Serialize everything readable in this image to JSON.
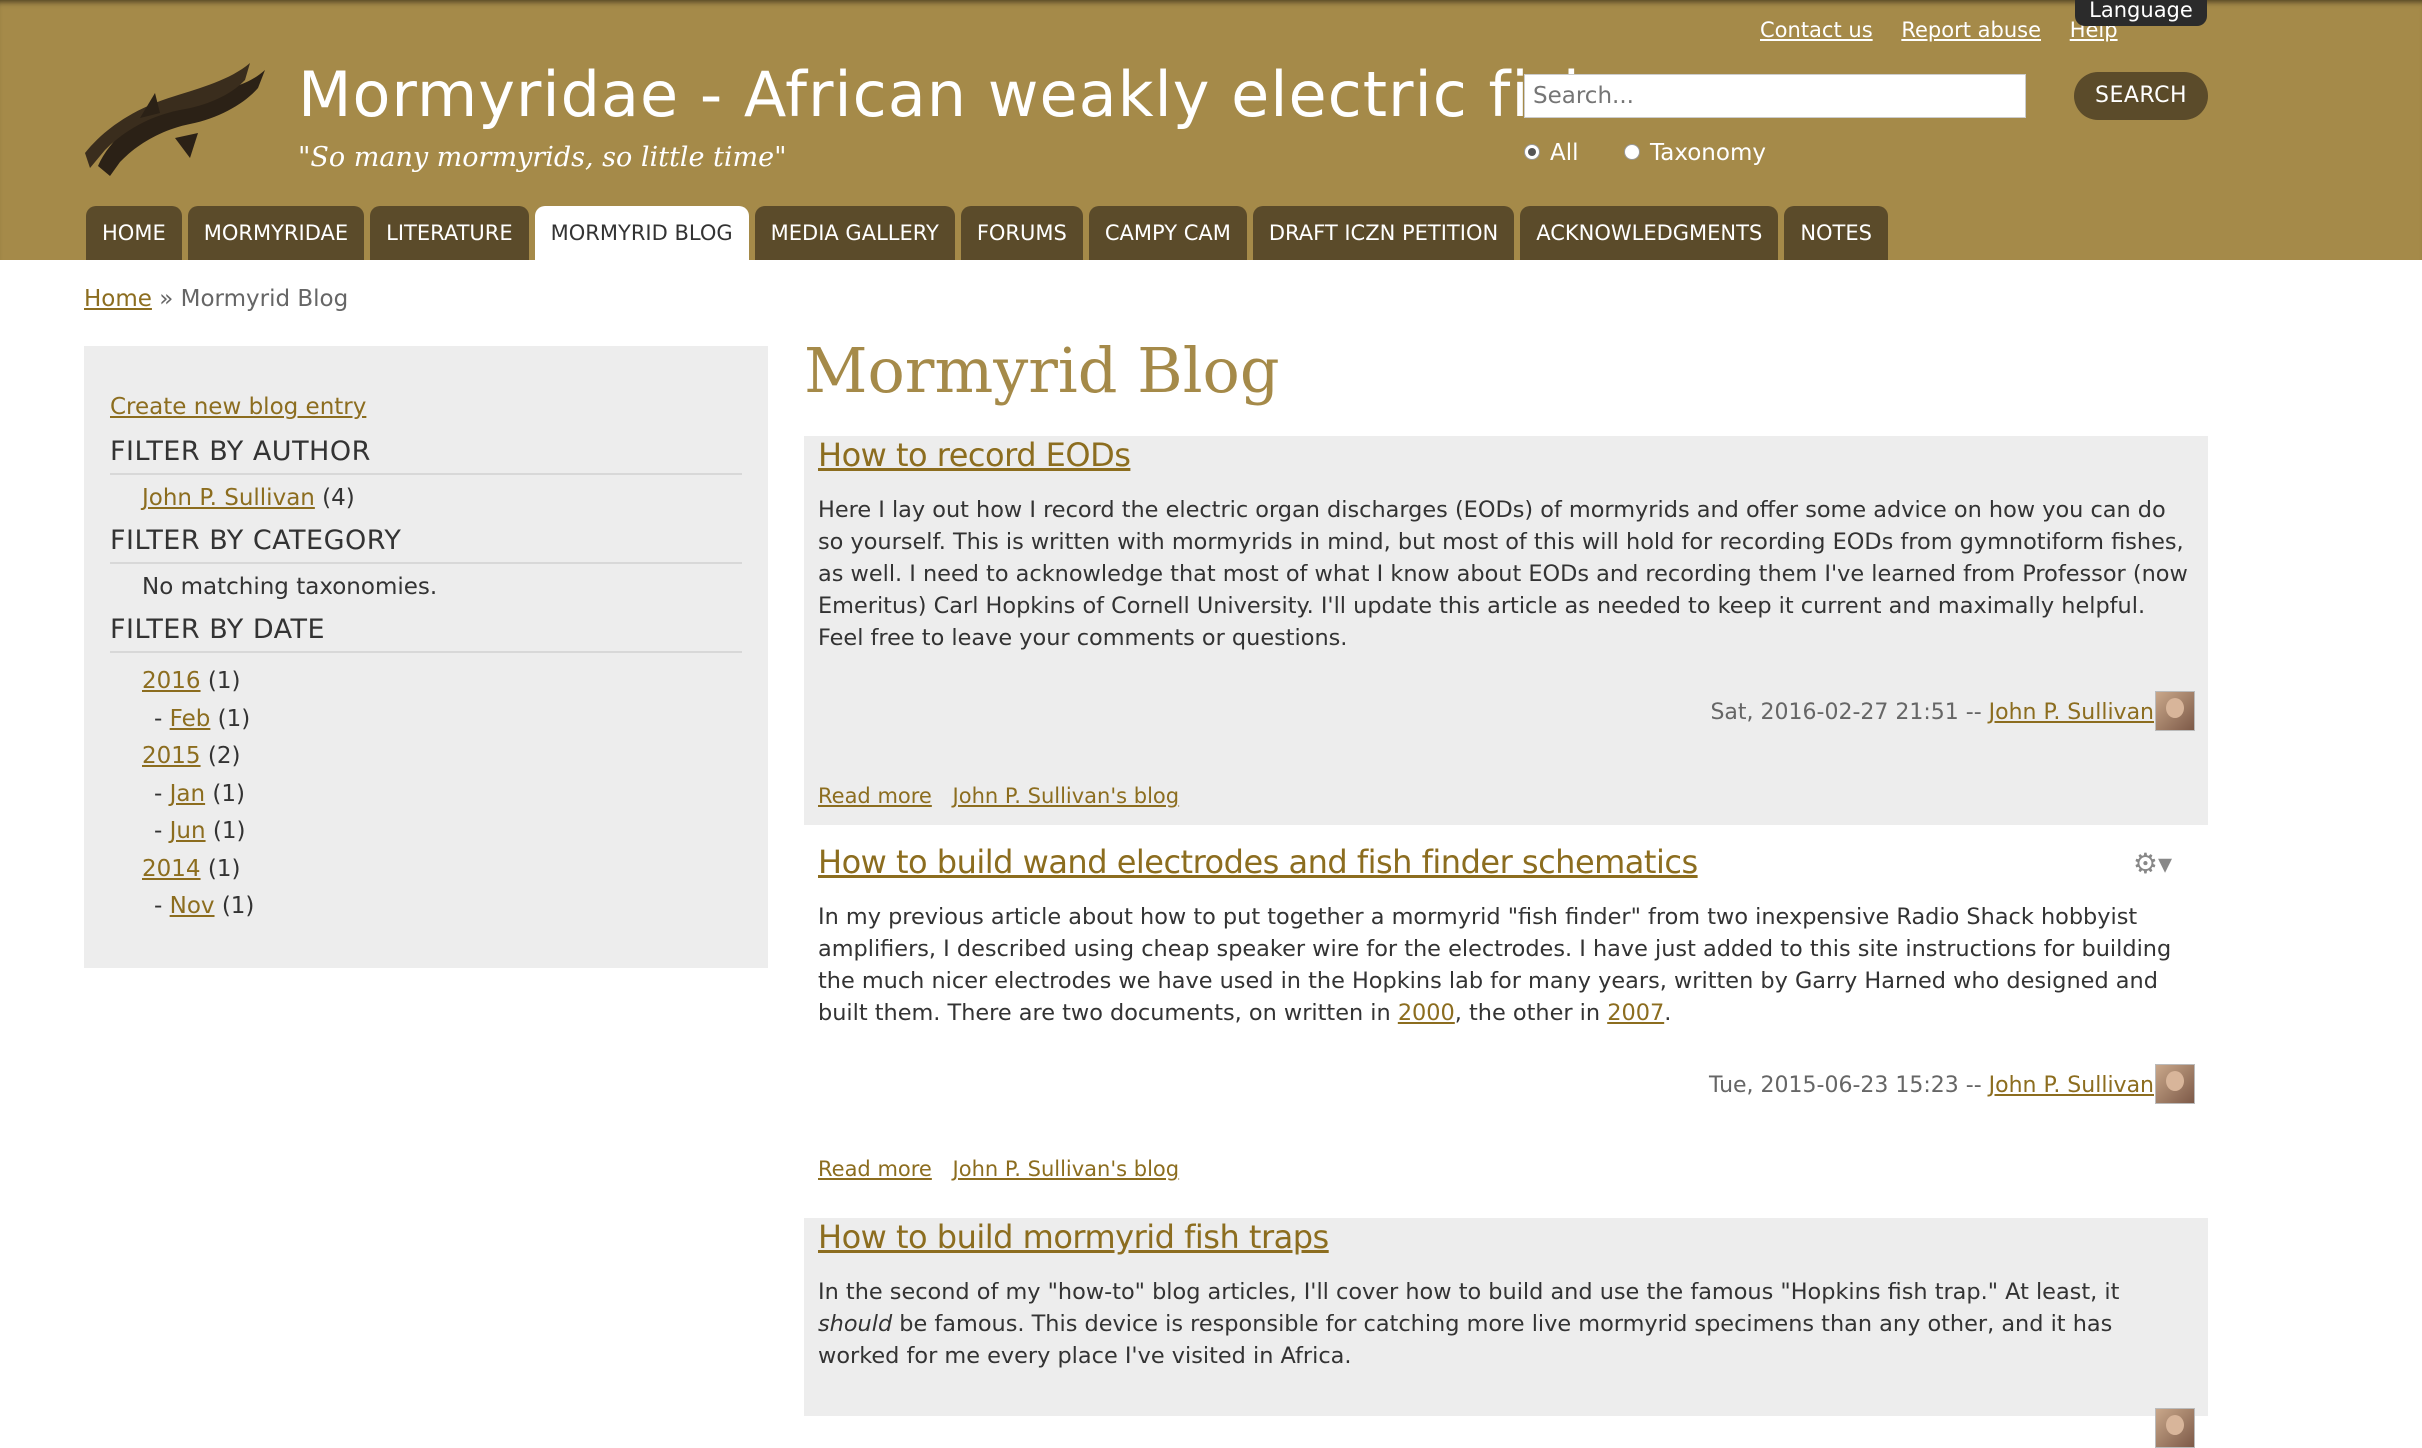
{
  "site": {
    "name": "Mormyridae - African weakly electric fishes",
    "slogan": "\"So many mormyrids, so little time\"",
    "secondary_links": [
      "Contact us",
      "Report abuse",
      "Help"
    ],
    "language_label": "Language"
  },
  "search": {
    "placeholder": "Search...",
    "button_label": "SEARCH",
    "options": [
      {
        "label": "All",
        "checked": true
      },
      {
        "label": "Taxonomy",
        "checked": false
      }
    ]
  },
  "nav": {
    "tabs": [
      {
        "label": "HOME",
        "active": false
      },
      {
        "label": "MORMYRIDAE",
        "active": false
      },
      {
        "label": "LITERATURE",
        "active": false
      },
      {
        "label": "MORMYRID BLOG",
        "active": true
      },
      {
        "label": "MEDIA GALLERY",
        "active": false
      },
      {
        "label": "FORUMS",
        "active": false
      },
      {
        "label": "CAMPY CAM",
        "active": false
      },
      {
        "label": "DRAFT ICZN PETITION",
        "active": false
      },
      {
        "label": "ACKNOWLEDGMENTS",
        "active": false
      },
      {
        "label": "NOTES",
        "active": false
      }
    ]
  },
  "breadcrumb": {
    "home": "Home",
    "sep": "»",
    "current": "Mormyrid Blog"
  },
  "sidebar": {
    "create_link": "Create new blog entry",
    "filter_author": {
      "title": "FILTER BY AUTHOR",
      "author": "John P. Sullivan",
      "count": "(4)"
    },
    "filter_category": {
      "title": "FILTER BY CATEGORY",
      "empty_text": "No matching taxonomies."
    },
    "filter_date": {
      "title": "FILTER BY DATE",
      "items": [
        {
          "prefix": "",
          "label": "2016",
          "count": "(1)",
          "month": false
        },
        {
          "prefix": "- ",
          "label": "Feb",
          "count": "(1)",
          "month": true
        },
        {
          "prefix": "",
          "label": "2015",
          "count": "(2)",
          "month": false
        },
        {
          "prefix": "- ",
          "label": "Jan",
          "count": "(1)",
          "month": true
        },
        {
          "prefix": "- ",
          "label": "Jun",
          "count": "(1)",
          "month": true
        },
        {
          "prefix": "",
          "label": "2014",
          "count": "(1)",
          "month": false
        },
        {
          "prefix": "- ",
          "label": "Nov",
          "count": "(1)",
          "month": true
        }
      ]
    }
  },
  "main": {
    "page_title": "Mormyrid Blog",
    "posts": [
      {
        "title": "How to record EODs",
        "body": "Here I lay out how I record the electric organ discharges (EODs) of mormyrids and offer some advice on how you can do so yourself. This is written with mormyrids in mind, but most of this will hold for recording EODs from gymnotiform fishes, as well. I need to acknowledge that most of what I know about EODs and recording them I've learned from Professor (now Emeritus) Carl Hopkins of Cornell University.  I'll update this article as needed to keep it current and maximally helpful. Feel free to leave your comments or questions.",
        "date": "Sat, 2016-02-27 21:51 --",
        "author": "John P. Sullivan",
        "read_more": "Read more",
        "blog_link": "John P. Sullivan's blog"
      },
      {
        "title": "How to build wand electrodes and fish finder schematics",
        "body_before": "In my previous article about how to put together a mormyrid \"fish finder\" from two inexpensive Radio Shack hobbyist amplifiers, I described using cheap speaker wire for the electrodes. I have just added to this site instructions for building the much nicer electrodes we have used in the Hopkins lab for many years, written by Garry Harned who designed and built them. There are two documents, on written in ",
        "link_2000": "2000",
        "body_middle": ", the other in ",
        "link_2007": "2007",
        "body_after": ".",
        "date": "Tue, 2015-06-23 15:23 --",
        "author": "John P. Sullivan",
        "read_more": "Read more",
        "blog_link": "John P. Sullivan's blog",
        "gear_glyph": "⚙▾"
      },
      {
        "title": "How to build mormyrid fish traps",
        "body_before": "In the second of my \"how-to\" blog articles, I'll cover how to build and use the famous \"Hopkins fish trap.\" At least, it ",
        "body_em": "should",
        "body_after": " be famous. This device is responsible for catching more live mormyrid specimens than any other, and it has worked for me every place I've visited in Africa."
      }
    ]
  },
  "colors": {
    "header_bg": "#a58a49",
    "tab_bg": "#5b4b2a",
    "link": "#8c6d1f",
    "sidebar_bg": "#ededed"
  }
}
